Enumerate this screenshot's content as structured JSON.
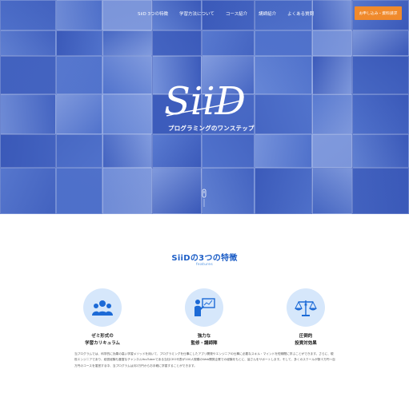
{
  "nav": {
    "items": [
      "SiiD 3つの特徴",
      "学習方法について",
      "コース紹介",
      "講師紹介",
      "よくある質問"
    ],
    "cta": "お申し込み・資料請求"
  },
  "hero": {
    "logo_text": "SiiD",
    "tagline": "プログラミングのワンステップ"
  },
  "features": {
    "title": "SiiDの3つの特徴",
    "subtitle": "features",
    "items": [
      {
        "label": "ゼミ形式の\n学習カリキュラム",
        "icon": "group-icon"
      },
      {
        "label": "強力な\n監修・講師陣",
        "icon": "instructor-presentation-icon"
      },
      {
        "label": "圧倒的\n投資対効果",
        "icon": "scale-yen-icon"
      }
    ],
    "description": "当プログラムでは、科学的に効果の高い学習メソッドを用いて、プログラミングを仕事にしたアプリ開発やエンジニアの仕事に必要なスキル・マインドを短期間に学ぶことができます。さらに、現役エンジニアであり、経営経験も豊富なチャンネルYouTuberである当社CEO代表が100人規模のWeb開発企業での経験をもとに、皆さんをサポートします。そして、多くのスクールが数十万円〜百万円のコースを運営する中、当プログラムは月2万円からお手軽に学習することができます。"
  },
  "colors": {
    "hero_blue": "#3f63c8",
    "accent_orange": "#f08a2c",
    "title_blue": "#1e5fc7",
    "icon_blue": "#1c6ad6",
    "circle_bg": "#d6e7fb"
  }
}
